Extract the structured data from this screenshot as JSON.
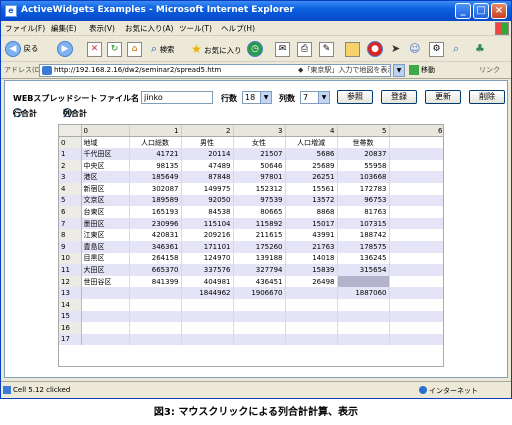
{
  "window": {
    "title": "ActiveWidgets Examples - Microsoft Internet Explorer"
  },
  "menu": [
    "ファイル(F)",
    "編集(E)",
    "表示(V)",
    "お気に入り(A)",
    "ツール(T)",
    "ヘルプ(H)"
  ],
  "toolbar": {
    "back": "戻る",
    "search": "検索",
    "favorites": "お気に入り"
  },
  "address": {
    "label": "アドレス(D)",
    "url": "http://192.168.2.16/dw2/seminar2/spread5.htm",
    "map_hint": "◆「東京駅」入力で地図を表示(JWord)",
    "go": "移動",
    "links": "リンク"
  },
  "form": {
    "title": "WEBスプレッドシート",
    "filename_label": "ファイル名",
    "filename": "jinko",
    "rows_label": "行数",
    "rows": "18",
    "cols_label": "列数",
    "cols": "7",
    "buttons": {
      "view": "参照",
      "register": "登録",
      "update": "更新",
      "delete": "削除"
    },
    "radio_row": "行合計",
    "radio_col": "列合計"
  },
  "grid": {
    "headers": [
      "",
      "0",
      "1",
      "2",
      "3",
      "4",
      "5",
      "6"
    ],
    "rows": [
      [
        "0",
        "地域",
        "人口総数",
        "男性",
        "女性",
        "人口増減",
        "世帯数",
        ""
      ],
      [
        "1",
        "千代田区",
        "41721",
        "20114",
        "21507",
        "5686",
        "20837",
        ""
      ],
      [
        "2",
        "中央区",
        "98135",
        "47489",
        "50646",
        "25689",
        "55958",
        ""
      ],
      [
        "3",
        "港区",
        "185649",
        "87848",
        "97801",
        "26251",
        "103668",
        ""
      ],
      [
        "4",
        "新宿区",
        "302087",
        "149975",
        "152312",
        "15561",
        "172783",
        ""
      ],
      [
        "5",
        "文京区",
        "189589",
        "92050",
        "97539",
        "13572",
        "96753",
        ""
      ],
      [
        "6",
        "台東区",
        "165193",
        "84538",
        "80665",
        "8868",
        "81763",
        ""
      ],
      [
        "7",
        "墨田区",
        "230996",
        "115104",
        "115892",
        "15017",
        "107315",
        ""
      ],
      [
        "8",
        "江東区",
        "420831",
        "209216",
        "211615",
        "43991",
        "188742",
        ""
      ],
      [
        "9",
        "豊島区",
        "346361",
        "171101",
        "175260",
        "21763",
        "178575",
        ""
      ],
      [
        "10",
        "目黒区",
        "264158",
        "124970",
        "139188",
        "14018",
        "136245",
        ""
      ],
      [
        "11",
        "大田区",
        "665370",
        "337576",
        "327794",
        "15839",
        "315654",
        ""
      ],
      [
        "12",
        "世田谷区",
        "841399",
        "404981",
        "436451",
        "26498",
        "",
        ""
      ],
      [
        "13",
        "",
        "",
        "1844962",
        "1906670",
        "",
        "1887060",
        ""
      ],
      [
        "14",
        "",
        "",
        "",
        "",
        "",
        "",
        ""
      ],
      [
        "15",
        "",
        "",
        "",
        "",
        "",
        "",
        ""
      ],
      [
        "16",
        "",
        "",
        "",
        "",
        "",
        "",
        ""
      ],
      [
        "17",
        "",
        "",
        "",
        "",
        "",
        "",
        ""
      ]
    ]
  },
  "status": {
    "text": "Cell 5.12 clicked",
    "zone": "インターネット"
  },
  "caption": "図3: マウスクリックによる列合計計算、表示"
}
